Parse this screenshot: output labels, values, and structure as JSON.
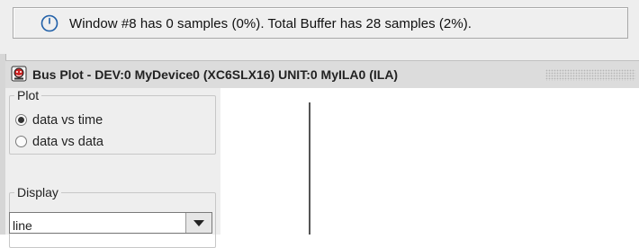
{
  "status": {
    "icon": "clock-icon",
    "text": "Window #8 has 0 samples (0%).  Total Buffer has 28 samples (2%)."
  },
  "window": {
    "icon": "app-logo-icon",
    "title": "Bus Plot - DEV:0 MyDevice0 (XC6SLX16) UNIT:0 MyILA0 (ILA)"
  },
  "plot_group": {
    "legend": "Plot",
    "options": [
      {
        "label": "data vs time",
        "selected": true
      },
      {
        "label": "data vs data",
        "selected": false
      }
    ]
  },
  "display_group": {
    "legend": "Display",
    "selected": "line"
  },
  "colors": {
    "accent": "#1f5fa8",
    "panel_bg": "#eeeeee",
    "plot_bg": "#ffffff"
  }
}
